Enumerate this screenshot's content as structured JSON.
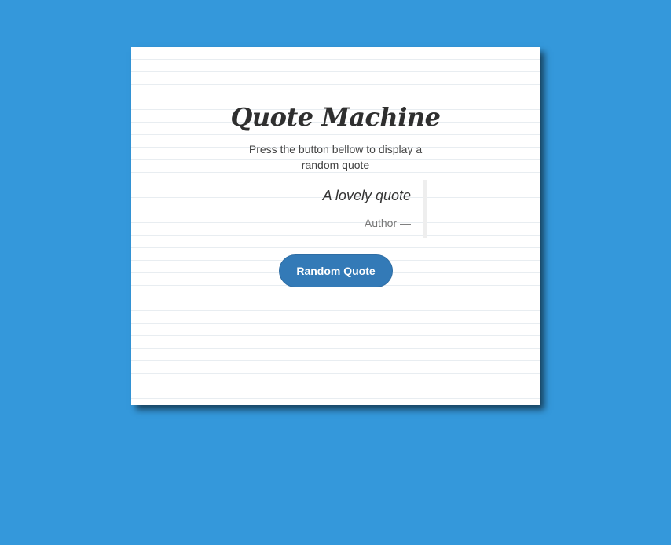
{
  "app": {
    "title": "Quote Machine",
    "subtitle": "Press the button bellow to display a random quote"
  },
  "quote": {
    "text": "A lovely quote",
    "author": "Author —"
  },
  "actions": {
    "random_quote_label": "Random Quote"
  },
  "colors": {
    "background": "#3498db",
    "paper": "#ffffff",
    "rule_lines": "#e8edf1",
    "margin_line": "#9cc8d8",
    "button": "#337ab7"
  }
}
